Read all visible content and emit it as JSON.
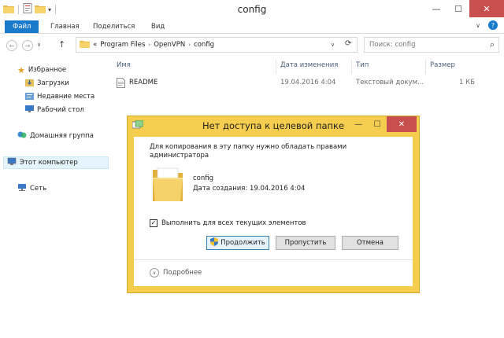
{
  "window": {
    "title": "config",
    "controls": {
      "minimize": "—",
      "maximize": "☐",
      "close": "✕"
    }
  },
  "ribbon": {
    "tabs": [
      "Файл",
      "Главная",
      "Поделиться",
      "Вид"
    ],
    "help": "?",
    "expand": "∨"
  },
  "address": {
    "back": "←",
    "forward": "→",
    "recent": "∨",
    "up": "↑",
    "overflow": "«",
    "crumbs": [
      "Program Files",
      "OpenVPN",
      "config"
    ],
    "refresh": "⟳",
    "dropdown": "∨",
    "search_placeholder": "Поиск: config",
    "search_icon": "⌕"
  },
  "nav": {
    "favorites": "Избранное",
    "downloads": "Загрузки",
    "recent_places": "Недавние места",
    "desktop": "Рабочий стол",
    "homegroup": "Домашняя группа",
    "this_pc": "Этот компьютер",
    "network": "Сеть"
  },
  "columns": {
    "name": "Имя",
    "date": "Дата изменения",
    "type": "Тип",
    "size": "Размер"
  },
  "files": [
    {
      "name": "README",
      "date": "19.04.2016 4:04",
      "type": "Текстовый докум...",
      "size": "1 КБ"
    }
  ],
  "dialog": {
    "title": "Нет доступа к целевой папке",
    "minimize": "—",
    "maximize": "☐",
    "close": "✕",
    "message": "Для копирования в эту папку нужно обладать правами администратора",
    "item_name": "config",
    "item_date": "Дата создания: 19.04.2016 4:04",
    "check_label": "Выполнить для всех текущих элементов",
    "checked": true,
    "check_mark": "✓",
    "btn_continue": "Продолжить",
    "btn_skip": "Пропустить",
    "btn_cancel": "Отмена",
    "more": "Подробнее",
    "more_arrow": "∨"
  },
  "colors": {
    "accent": "#1979ca",
    "dialog_frame": "#f5ce4f",
    "close_red": "#c7504f",
    "selection": "#e5f3fb"
  }
}
